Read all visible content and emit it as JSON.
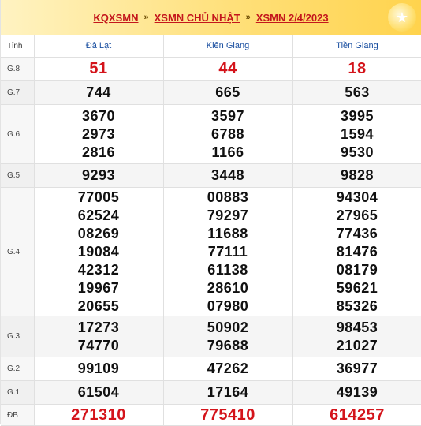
{
  "breadcrumb": {
    "items": [
      "KQXSMN",
      "XSMN CHỦ NHẬT",
      "XSMN 2/4/2023"
    ],
    "separator": "»"
  },
  "table": {
    "tinh_label": "Tỉnh",
    "provinces": [
      "Đà Lạt",
      "Kiên Giang",
      "Tiền Giang"
    ],
    "rows": [
      {
        "label": "G.8",
        "values": [
          [
            "51"
          ],
          [
            "44"
          ],
          [
            "18"
          ]
        ]
      },
      {
        "label": "G.7",
        "values": [
          [
            "744"
          ],
          [
            "665"
          ],
          [
            "563"
          ]
        ]
      },
      {
        "label": "G.6",
        "values": [
          [
            "3670",
            "2973",
            "2816"
          ],
          [
            "3597",
            "6788",
            "1166"
          ],
          [
            "3995",
            "1594",
            "9530"
          ]
        ]
      },
      {
        "label": "G.5",
        "values": [
          [
            "9293"
          ],
          [
            "3448"
          ],
          [
            "9828"
          ]
        ]
      },
      {
        "label": "G.4",
        "values": [
          [
            "77005",
            "62524",
            "08269",
            "19084",
            "42312",
            "19967",
            "20655"
          ],
          [
            "00883",
            "79297",
            "11688",
            "77111",
            "61138",
            "28610",
            "07980"
          ],
          [
            "94304",
            "27965",
            "77436",
            "81476",
            "08179",
            "59621",
            "85326"
          ]
        ]
      },
      {
        "label": "G.3",
        "values": [
          [
            "17273",
            "74770"
          ],
          [
            "50902",
            "79688"
          ],
          [
            "98453",
            "21027"
          ]
        ]
      },
      {
        "label": "G.2",
        "values": [
          [
            "99109"
          ],
          [
            "47262"
          ],
          [
            "36977"
          ]
        ]
      },
      {
        "label": "G.1",
        "values": [
          [
            "61504"
          ],
          [
            "17164"
          ],
          [
            "49139"
          ]
        ]
      },
      {
        "label": "ĐB",
        "values": [
          [
            "271310"
          ],
          [
            "775410"
          ],
          [
            "614257"
          ]
        ]
      }
    ]
  },
  "colors": {
    "accent_red": "#d4141b",
    "province_blue": "#1a4fa0",
    "header_gold": "#ffd34d"
  }
}
